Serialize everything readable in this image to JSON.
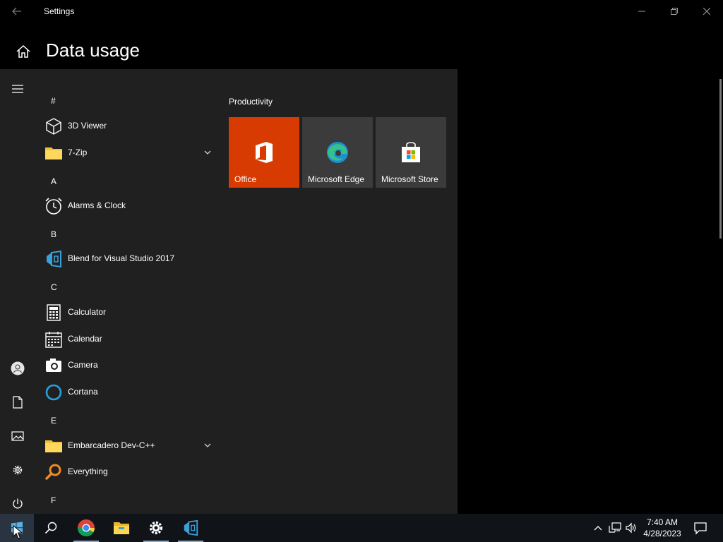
{
  "window": {
    "title": "Settings",
    "page_title": "Data usage"
  },
  "start_menu": {
    "groups": [
      {
        "header": "#",
        "items": [
          {
            "label": "3D Viewer",
            "icon": "cube-icon"
          },
          {
            "label": "7-Zip",
            "icon": "folder-icon",
            "expandable": true
          }
        ]
      },
      {
        "header": "A",
        "items": [
          {
            "label": "Alarms & Clock",
            "icon": "alarm-clock-icon"
          }
        ]
      },
      {
        "header": "B",
        "items": [
          {
            "label": "Blend for Visual Studio 2017",
            "icon": "blend-icon"
          }
        ]
      },
      {
        "header": "C",
        "items": [
          {
            "label": "Calculator",
            "icon": "calculator-icon"
          },
          {
            "label": "Calendar",
            "icon": "calendar-icon"
          },
          {
            "label": "Camera",
            "icon": "camera-icon"
          },
          {
            "label": "Cortana",
            "icon": "cortana-icon"
          }
        ]
      },
      {
        "header": "E",
        "items": [
          {
            "label": "Embarcadero Dev-C++",
            "icon": "folder-icon",
            "expandable": true
          },
          {
            "label": "Everything",
            "icon": "magnifier-icon"
          }
        ]
      },
      {
        "header": "F",
        "items": []
      }
    ],
    "tiles_group": "Productivity",
    "tiles": [
      {
        "label": "Office",
        "icon": "office-icon",
        "bg": "#d83b01"
      },
      {
        "label": "Microsoft Edge",
        "icon": "edge-icon",
        "bg": "#3b3b3b"
      },
      {
        "label": "Microsoft Store",
        "icon": "store-icon",
        "bg": "#3b3b3b"
      }
    ]
  },
  "taskbar": {
    "apps": [
      "start-icon",
      "search-icon",
      "chrome-icon",
      "file-explorer-icon",
      "settings-icon",
      "blend-icon"
    ],
    "time": "7:40 AM",
    "date": "4/28/2023"
  },
  "colors": {
    "start_bg": "#202020",
    "office_tile": "#d83b01",
    "tile_bg": "#3b3b3b",
    "taskbar_bg": "#101418"
  }
}
